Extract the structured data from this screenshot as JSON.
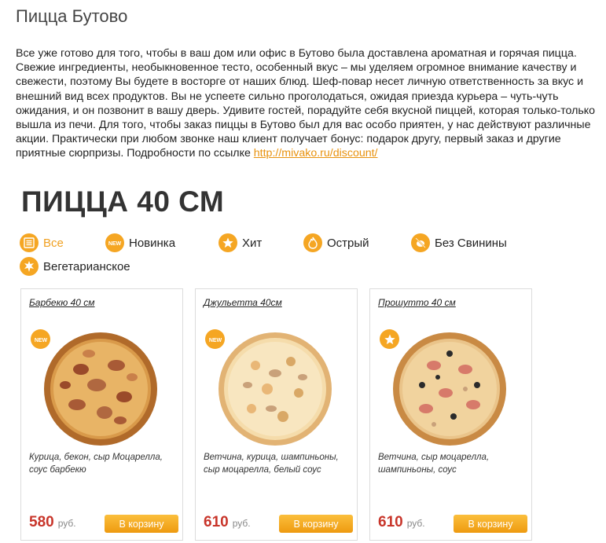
{
  "page": {
    "title": "Пицца Бутово",
    "intro_text": "Все уже готово для того, чтобы в ваш дом или офис в Бутово была доставлена ароматная и горячая пицца. Свежие ингредиенты, необыкновенное тесто, особенный вкус – мы уделяем огромное внимание качеству и свежести, поэтому Вы будете в восторге от наших блюд. Шеф-повар несет личную ответственность за вкус и внешний вид всех продуктов. Вы не успеете сильно проголодаться, ожидая приезда курьера – чуть-чуть ожидания, и он позвонит в вашу дверь. Удивите гостей, порадуйте себя вкусной пиццей, которая только-только вышла из печи. Для того, чтобы заказ пиццы в Бутово был для вас особо приятен, у нас действуют различные акции. Практически при любом звонке наш клиент получает бонус: подарок другу, первый заказ и другие приятные сюрпризы. Подробности по ссылке ",
    "intro_link": "http://mivako.ru/discount/"
  },
  "section": {
    "title": "ПИЦЦА 40 СМ"
  },
  "filters": [
    {
      "label": "Все",
      "icon": "menu-list-icon",
      "active": true
    },
    {
      "label": "Новинка",
      "icon": "new-badge-icon",
      "active": false
    },
    {
      "label": "Хит",
      "icon": "star-icon",
      "active": false
    },
    {
      "label": "Острый",
      "icon": "flame-icon",
      "active": false
    },
    {
      "label": "Без Свинины",
      "icon": "no-pork-icon",
      "active": false
    },
    {
      "label": "Вегетарианское",
      "icon": "leaf-icon",
      "active": false
    }
  ],
  "products": [
    {
      "name": "Барбекю 40 см",
      "badge": "NEW",
      "badge_icon": "new-badge-icon",
      "description": "Курица, бекон, сыр Моцарелла, соус барбекю",
      "price": "580",
      "currency": "руб.",
      "button": "В корзину"
    },
    {
      "name": "Джульетта 40см",
      "badge": "NEW",
      "badge_icon": "new-badge-icon",
      "description": "Ветчина, курица, шампиньоны, сыр моцарелла, белый соус",
      "price": "610",
      "currency": "руб.",
      "button": "В корзину"
    },
    {
      "name": "Прошутто 40 см",
      "badge": "",
      "badge_icon": "star-icon",
      "description": "Ветчина, сыр моцарелла, шампиньоны, соус",
      "price": "610",
      "currency": "руб.",
      "button": "В корзину"
    }
  ],
  "colors": {
    "accent": "#f5a623",
    "price": "#c8352a",
    "link": "#e8920e"
  }
}
